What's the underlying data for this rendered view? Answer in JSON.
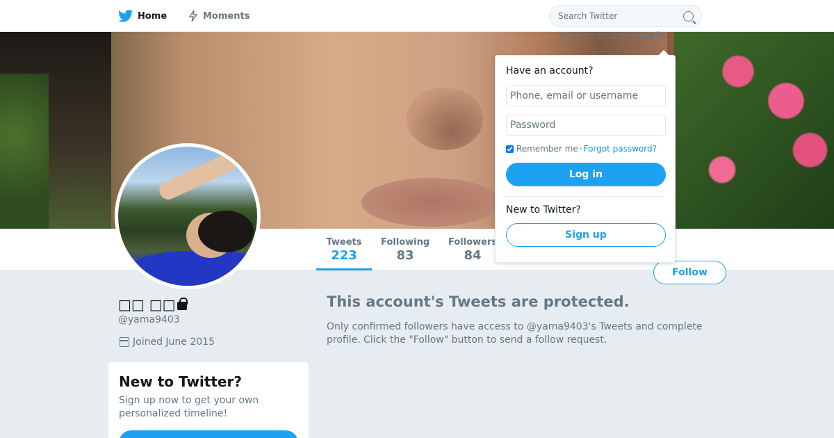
{
  "nav": {
    "home_label": "Home",
    "moments_label": "Moments",
    "search_placeholder": "Search Twitter",
    "have_account_text": "Have an account?",
    "login_link": "Log in"
  },
  "profile": {
    "display_name": "□□ □□",
    "handle": "@yama9403",
    "joined": "Joined June 2015",
    "stats": [
      {
        "label": "Tweets",
        "value": "223"
      },
      {
        "label": "Following",
        "value": "83"
      },
      {
        "label": "Followers",
        "value": "84"
      }
    ],
    "follow_button": "Follow"
  },
  "protected": {
    "title": "This account's Tweets are protected.",
    "body": "Only confirmed followers have access to @yama9403's Tweets and complete profile. Click the \"Follow\" button to send a follow request."
  },
  "new_card": {
    "title": "New to Twitter?",
    "body": "Sign up now to get your own personalized timeline!"
  },
  "login_dropdown": {
    "title": "Have an account?",
    "username_placeholder": "Phone, email or username",
    "password_placeholder": "Password",
    "remember_label": "Remember me",
    "separator": "·",
    "forgot_link": "Forgot password?",
    "login_button": "Log in",
    "new_title": "New to Twitter?",
    "signup_button": "Sign up"
  },
  "colors": {
    "accent": "#1da1f2",
    "background": "#e6ecf0",
    "muted_text": "#657786"
  }
}
